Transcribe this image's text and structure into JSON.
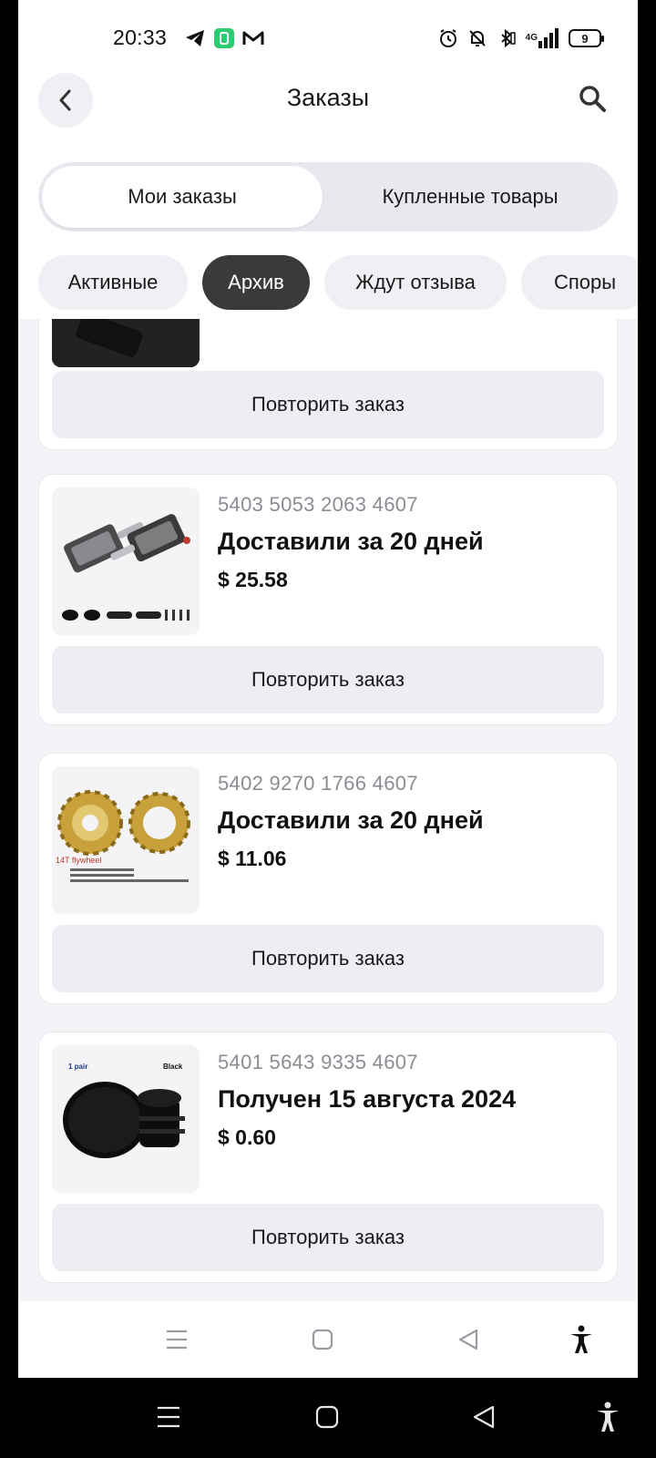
{
  "status_bar": {
    "time": "20:33",
    "battery": "9",
    "network_label": "4G",
    "left_icons": [
      "telegram-icon",
      "notification-app-icon",
      "mail-icon"
    ],
    "right_icons": [
      "alarm-icon",
      "dnd-icon",
      "bluetooth-icon",
      "signal-icon",
      "battery-icon"
    ]
  },
  "header": {
    "title": "Заказы",
    "back_icon": "chevron-left-icon",
    "search_icon": "search-icon"
  },
  "segments": {
    "active": "Мои заказы",
    "inactive": "Купленные товары"
  },
  "filters": [
    {
      "label": "Активные",
      "active": false
    },
    {
      "label": "Архив",
      "active": true
    },
    {
      "label": "Ждут отзыва",
      "active": false
    },
    {
      "label": "Споры",
      "active": false
    }
  ],
  "orders": [
    {
      "number": "",
      "status": "",
      "price": "",
      "repeat_label": "Повторить заказ",
      "thumb": "black-product-partial"
    },
    {
      "number": "5403 5053 2063 4607",
      "status": "Доставили за 20 дней",
      "price": "$ 25.58",
      "repeat_label": "Повторить заказ",
      "thumb": "bike-pedals"
    },
    {
      "number": "5402 9270 1766 4607",
      "status": "Доставили за 20 дней",
      "price": "$ 11.06",
      "repeat_label": "Повторить заказ",
      "thumb": "gold-freewheel",
      "thumb_caption": "14T flywheel"
    },
    {
      "number": "5401 5643 9335 4607",
      "status": "Получен 15 августа 2024",
      "price": "$ 0.60",
      "repeat_label": "Повторить заказ",
      "thumb": "black-bar-end-plugs",
      "thumb_labels": [
        "1 pair",
        "Black"
      ]
    }
  ],
  "colors": {
    "accent_dark": "#3a3a3c",
    "background": "#f3f4f7",
    "button": "#eceef3"
  }
}
